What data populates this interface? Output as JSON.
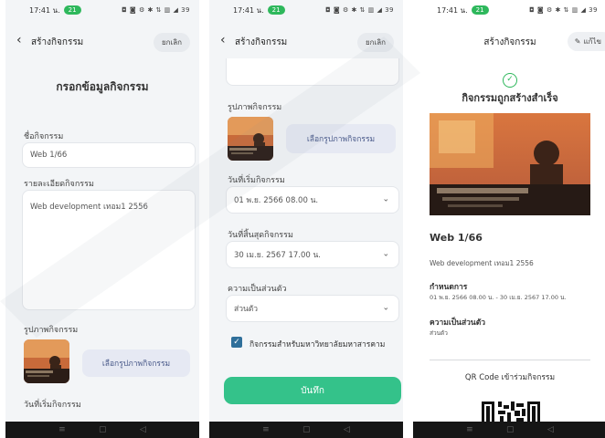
{
  "status_bar": {
    "time": "17:41 น.",
    "badge": "21",
    "icons": "◘ ◙ ⚙ ✱ ⇅ ▥ ◢ 39"
  },
  "screen1": {
    "title": "สร้างกิจกรรม",
    "cancel_label": "ยกเลิก",
    "heading": "กรอกข้อมูลกิจกรรม",
    "name_label": "ชื่อกิจกรรม",
    "name_value": "Web 1/66",
    "detail_label": "รายละเอียดกิจกรรม",
    "detail_value": "Web development เทอม1 2556",
    "image_label": "รูปภาพกิจกรรม",
    "pick_image_label": "เลือกรูปภาพกิจกรรม",
    "start_label": "วันที่เริ่มกิจกรรม"
  },
  "screen2": {
    "image_label": "รูปภาพกิจกรรม",
    "pick_image_label": "เลือกรูปภาพกิจกรรม",
    "start_label": "วันที่เริ่มกิจกรรม",
    "start_value": "01 พ.ย. 2566 08.00 น.",
    "end_label": "วันที่สิ้นสุดกิจกรรม",
    "end_value": "30 เม.ย. 2567 17.00 น.",
    "privacy_label": "ความเป็นส่วนตัว",
    "privacy_value": "ส่วนตัว",
    "checkbox_label": "กิจกรรมสำหรับมหาวิทยาลัยมหาสารคาม",
    "save_label": "บันทึก"
  },
  "screen3": {
    "title": "สร้างกิจกรรม",
    "edit_label": "แก้ไข",
    "success_text": "กิจกรรมถูกสร้างสำเร็จ",
    "activity_name": "Web 1/66",
    "activity_detail": "Web development เทอม1 2556",
    "schedule_label": "กำหนดการ",
    "schedule_value": "01 พ.ย. 2566 08.00 น. - 30 เม.ย. 2567 17.00 น.",
    "privacy_label": "ความเป็นส่วนตัว",
    "privacy_value": "ส่วนตัว",
    "qr_label": "QR Code เข้าร่วมกิจกรรม"
  },
  "navbar": {
    "menu_icon": "≡",
    "home_icon": "▢",
    "back_icon": "◁"
  },
  "icons": {
    "back": "chevron-left-icon",
    "chevron_down": "chevron-down-icon",
    "check": "check-icon",
    "success": "check-circle-icon",
    "edit": "pencil-icon"
  },
  "colors": {
    "accent_green": "#34c28a",
    "success_green": "#2eb85c",
    "checkbox_blue": "#2f6f9a",
    "pick_button_bg": "#e6e9f3"
  }
}
